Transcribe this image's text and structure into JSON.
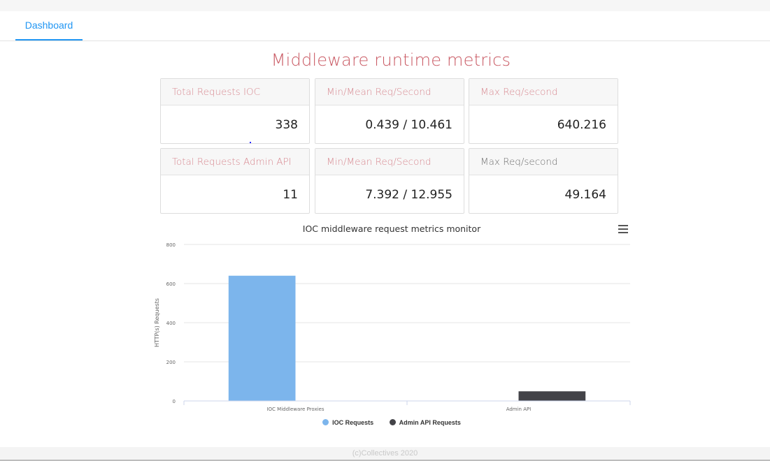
{
  "nav": {
    "tab_label": "Dashboard"
  },
  "page": {
    "title": "Middleware runtime metrics"
  },
  "cards": [
    {
      "header": "Total Requests IOC",
      "value": "338"
    },
    {
      "header": "Min/Mean Req/Second",
      "value": "0.439 / 10.461"
    },
    {
      "header": "Max Req/second",
      "value": "640.216"
    },
    {
      "header": "Total Requests Admin API",
      "value": "11"
    },
    {
      "header": "Min/Mean Req/Second",
      "value": "7.392 / 12.955"
    },
    {
      "header": "Max Req/second",
      "value": "49.164"
    }
  ],
  "chart_data": {
    "type": "bar",
    "title": "IOC middleware request metrics monitor",
    "ylabel": "HTTP(s) Requests",
    "xlabel": "",
    "categories": [
      "IOC Middleware Proxies",
      "Admin API"
    ],
    "yticks": [
      "0",
      "200",
      "400",
      "600",
      "800"
    ],
    "ylim": [
      0,
      800
    ],
    "grid": true,
    "legend_position": "bottom",
    "series": [
      {
        "name": "IOC Requests",
        "color": "#7cb5ec",
        "values": [
          640.216,
          null
        ]
      },
      {
        "name": "Admin API Requests",
        "color": "#434348",
        "values": [
          null,
          49.164
        ]
      }
    ]
  },
  "footer": {
    "text": "(c)Collectives 2020"
  },
  "icons": {
    "chart_menu": "hamburger-menu-icon"
  }
}
